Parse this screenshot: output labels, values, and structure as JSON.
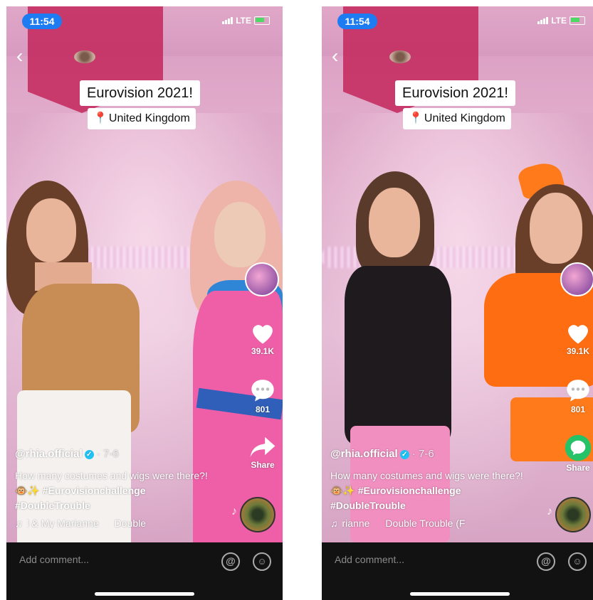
{
  "screens": [
    {
      "status": {
        "time": "11:54",
        "network": "LTE"
      },
      "title": "Eurovision 2021!",
      "location": "United Kingdom",
      "likes": "39.1K",
      "comments": "801",
      "share_label": "Share",
      "username": "@rhia.official",
      "date": "· 7-6",
      "caption_text": "How many costumes and wigs were there?!🐵✨ ",
      "hashtag1": "#Eurovisionchallenge",
      "hashtag2": "#DoubleTrouble",
      "music_part1": "l & My Marianne",
      "music_part2": "Double",
      "comment_placeholder": "Add comment...",
      "colors": {
        "share_circle": "none"
      }
    },
    {
      "status": {
        "time": "11:54",
        "network": "LTE"
      },
      "title": "Eurovision 2021!",
      "location": "United Kingdom",
      "likes": "39.1K",
      "comments": "801",
      "share_label": "Share",
      "username": "@rhia.official",
      "date": "· 7-6",
      "caption_text": "How many costumes and wigs were there?!🐵✨ ",
      "hashtag1": "#Eurovisionchallenge",
      "hashtag2": "#DoubleTrouble",
      "music_part1": "rianne",
      "music_part2": "Double Trouble (F",
      "comment_placeholder": "Add comment...",
      "colors": {
        "share_circle": "#26c268"
      }
    }
  ],
  "icons": {
    "back": "chevron-left-icon",
    "pin": "map-pin-icon",
    "verified": "verified-badge-icon",
    "like": "heart-icon",
    "comment": "comment-bubble-icon",
    "share_left": "share-arrow-icon",
    "share_right": "whatsapp-share-icon",
    "music": "music-note-icon",
    "at": "at-mention-icon",
    "emoji": "emoji-icon"
  }
}
